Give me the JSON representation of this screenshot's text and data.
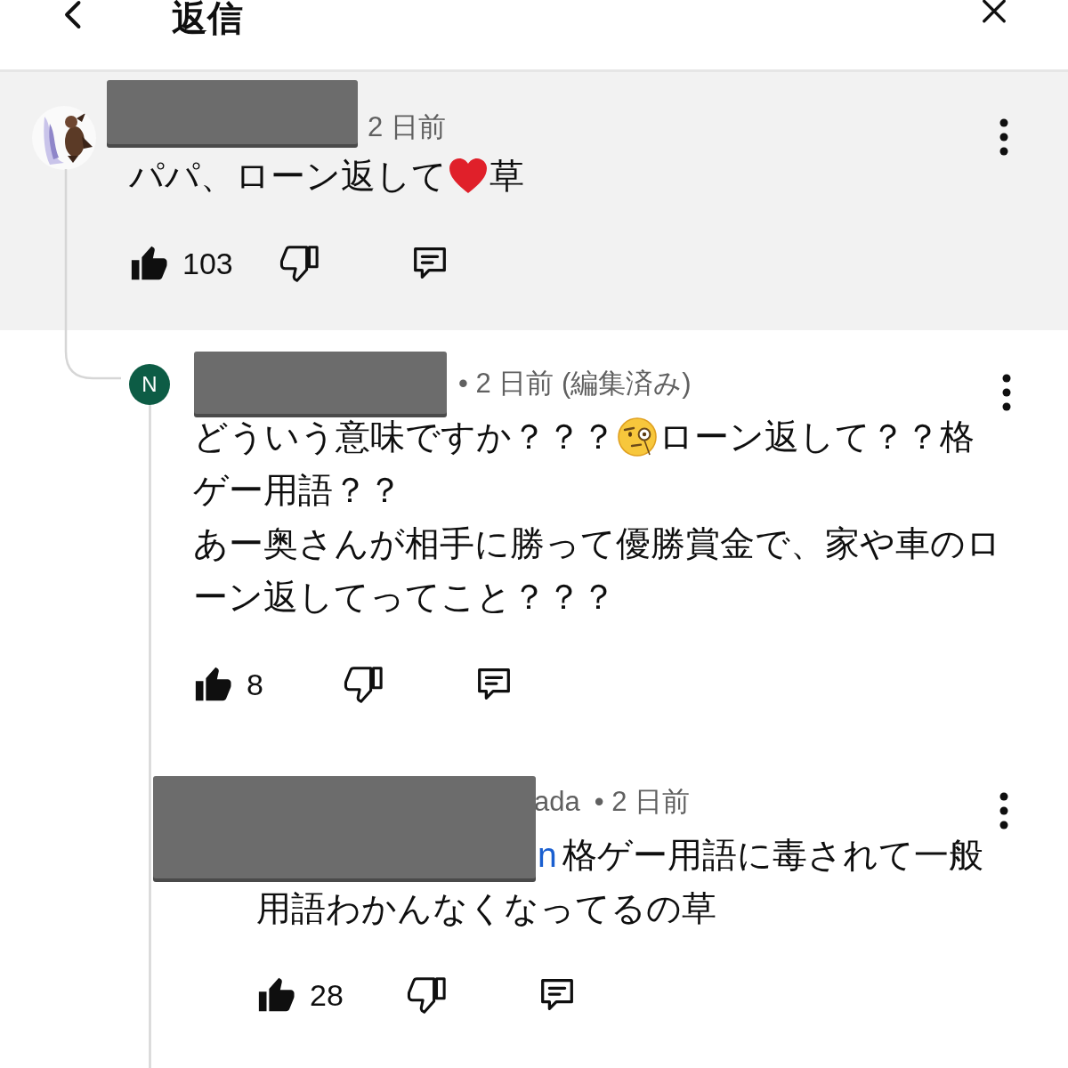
{
  "header": {
    "title": "返信"
  },
  "comments": [
    {
      "avatar": {
        "kind": "picture"
      },
      "time": "2 日前",
      "lines": [
        [
          {
            "kind": "text",
            "text": "パパ、ローン返して"
          },
          {
            "kind": "heart_emoji"
          },
          {
            "kind": "text",
            "text": "草"
          }
        ]
      ],
      "likes": "103",
      "replies": [
        {
          "avatar": {
            "kind": "letter",
            "letter": "N"
          },
          "time": "• 2 日前 (編集済み)",
          "lines": [
            [
              {
                "kind": "text",
                "text": "どういう意味ですか？？？"
              },
              {
                "kind": "monocle_emoji"
              },
              {
                "kind": "text",
                "text": "ローン返して？？格"
              }
            ],
            [
              {
                "kind": "text",
                "text": "ゲー用語？？"
              }
            ],
            [
              {
                "kind": "text",
                "text": "あー奥さんが相手に勝って優勝賞金で、家や車のロ"
              }
            ],
            [
              {
                "kind": "text",
                "text": "ーン返してってこと？？？"
              }
            ]
          ],
          "likes": "8",
          "replies": [
            {
              "name_fragment": "ada",
              "time": "• 2 日前",
              "lines": [
                [
                  {
                    "kind": "mention",
                    "text": "n"
                  },
                  {
                    "kind": "text",
                    "text": "格ゲー用語に毒されて一般"
                  }
                ],
                [
                  {
                    "kind": "text",
                    "text": "用語わかんなくなってるの草"
                  }
                ]
              ],
              "likes": "28"
            }
          ]
        }
      ]
    }
  ]
}
